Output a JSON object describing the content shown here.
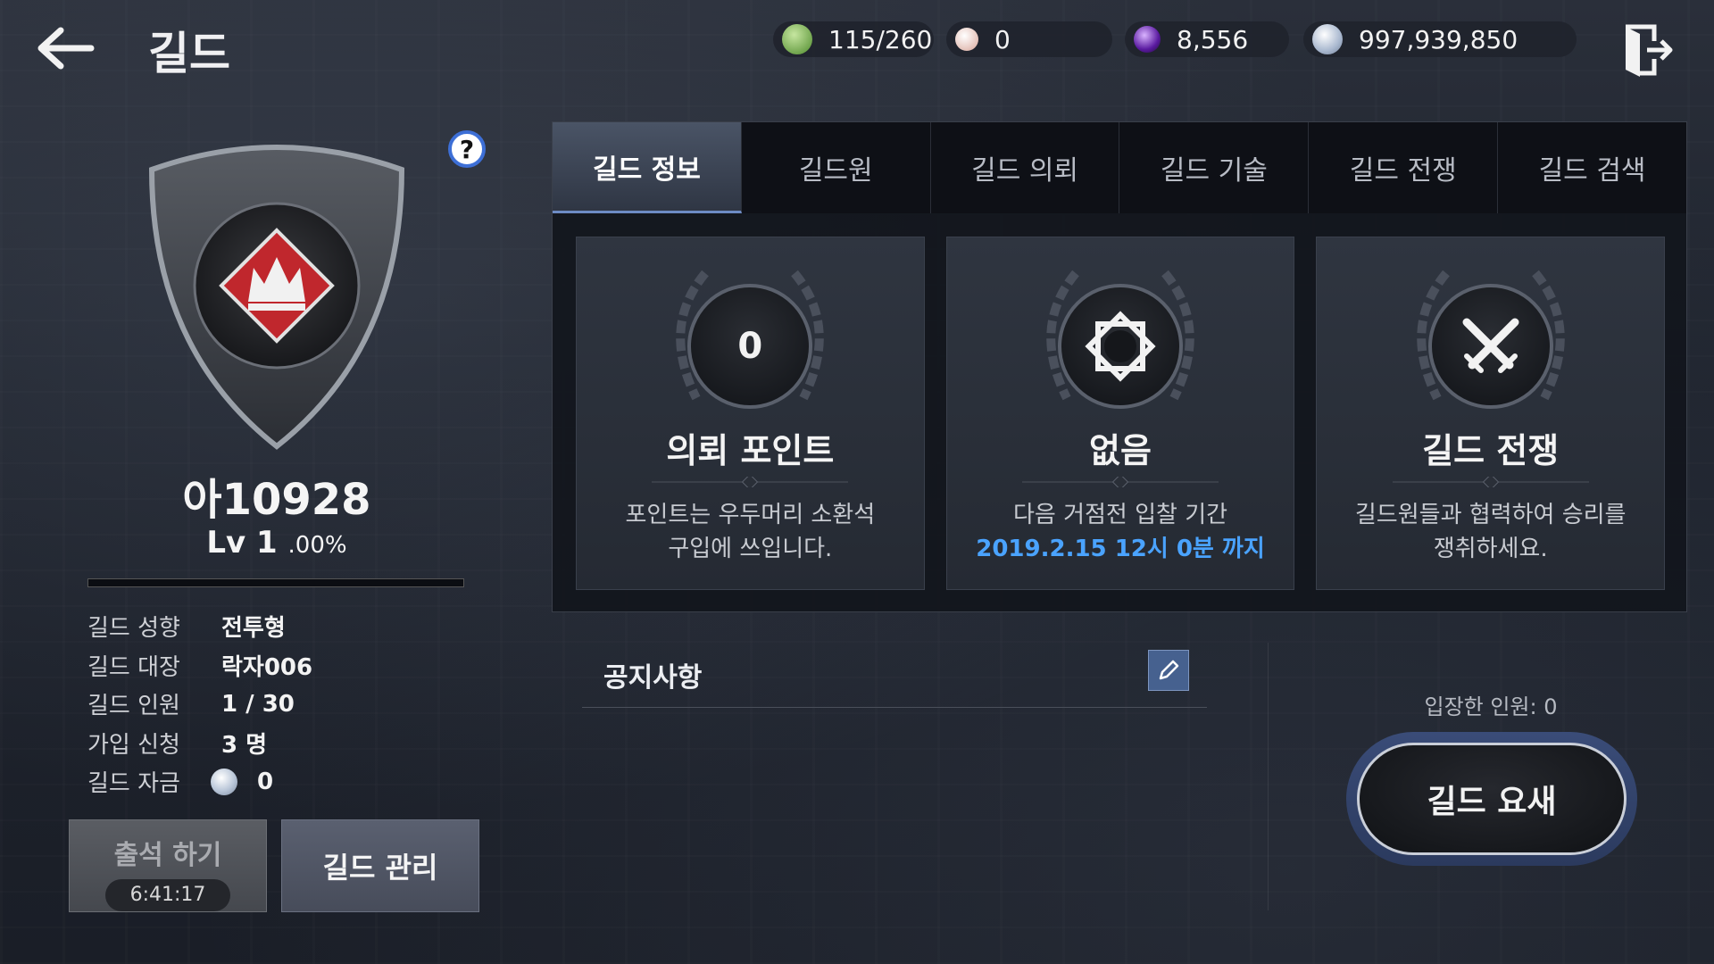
{
  "header": {
    "title": "길드",
    "currencies": [
      {
        "icon": "stamina-icon",
        "value": "115/260",
        "color": "#6aa84f"
      },
      {
        "icon": "pearl-icon",
        "value": "0",
        "color": "#e8c4b8"
      },
      {
        "icon": "purple-gem-icon",
        "value": "8,556",
        "color": "#8a3fd1"
      },
      {
        "icon": "silver-coin-icon",
        "value": "997,939,850",
        "color": "#c7d2e3"
      }
    ]
  },
  "guild": {
    "name": "아10928",
    "level": "Lv 1",
    "level_percent": ".00%",
    "xp_fraction": 0.0,
    "info": [
      {
        "label": "길드 성향",
        "value": "전투형"
      },
      {
        "label": "길드 대장",
        "value": "락자006"
      },
      {
        "label": "길드 인원",
        "value": "1 / 30"
      },
      {
        "label": "가입 신청",
        "value": "3 명"
      },
      {
        "label": "길드 자금",
        "value": "0"
      }
    ]
  },
  "buttons": {
    "attend": "출석 하기",
    "attend_timer": "6:41:17",
    "manage": "길드 관리",
    "help": "?"
  },
  "tabs": [
    "길드 정보",
    "길드원",
    "길드 의뢰",
    "길드 기술",
    "길드 전쟁",
    "길드 검색"
  ],
  "cards": [
    {
      "icon_text": "0",
      "title": "의뢰 포인트",
      "desc_line1": "포인트는 우두머리 소환석",
      "desc_line2": "구입에 쓰입니다."
    },
    {
      "icon": "stronghold-icon",
      "title": "없음",
      "desc_line1": "다음 거점전 입찰 기간",
      "desc_line2": "2019.2.15 12시 0분 까지"
    },
    {
      "icon": "crossed-swords-icon",
      "title": "길드 전쟁",
      "desc_line1": "길드원들과 협력하여 승리를",
      "desc_line2": "쟁취하세요."
    }
  ],
  "notice": {
    "title": "공지사항"
  },
  "fortress": {
    "entered": "입장한 인원: 0",
    "button": "길드 요새"
  },
  "colors": {
    "accent_blue": "#4aa3ff",
    "tab_active": "#4a5466",
    "emblem_red": "#c0272d"
  }
}
